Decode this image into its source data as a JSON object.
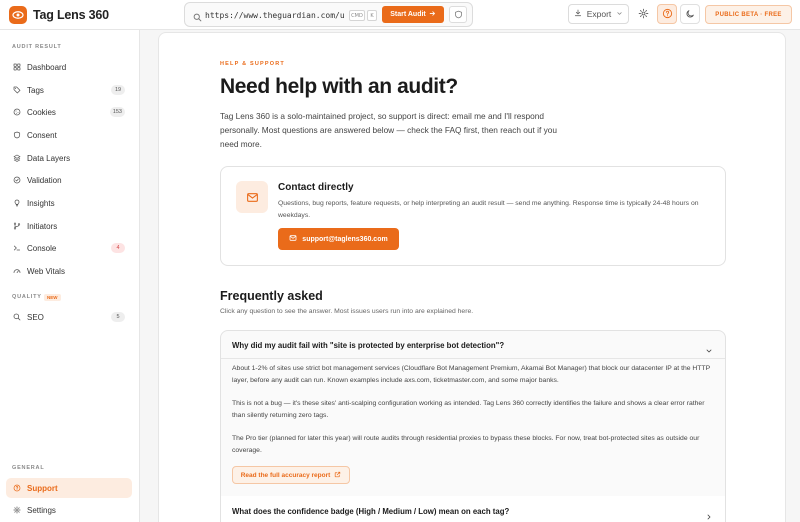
{
  "app": {
    "name": "Tag Lens 360"
  },
  "topbar": {
    "url_value": "https://www.theguardian.com/uk",
    "kbd_mod": "CMD",
    "kbd_key": "K",
    "start_label": "Start Audit",
    "export_label": "Export",
    "beta_label": "PUBLIC BETA · FREE"
  },
  "sidebar": {
    "section_audit": "AUDIT RESULT",
    "items": [
      {
        "label": "Dashboard",
        "icon": "grid-icon"
      },
      {
        "label": "Tags",
        "count": "19",
        "icon": "tag-icon"
      },
      {
        "label": "Cookies",
        "count": "153",
        "icon": "cookie-icon"
      },
      {
        "label": "Consent",
        "icon": "shield-icon"
      },
      {
        "label": "Data Layers",
        "icon": "layers-icon"
      },
      {
        "label": "Validation",
        "icon": "check-circle-icon"
      },
      {
        "label": "Insights",
        "icon": "lightbulb-icon"
      },
      {
        "label": "Initiators",
        "icon": "branch-icon"
      },
      {
        "label": "Console",
        "count": "4",
        "icon": "terminal-icon"
      },
      {
        "label": "Web Vitals",
        "icon": "gauge-icon"
      }
    ],
    "section_quality": "QUALITY",
    "quality_badge": "NEW",
    "seo": {
      "label": "SEO",
      "count": "5"
    },
    "section_general": "GENERAL",
    "support": {
      "label": "Support"
    },
    "settings": {
      "label": "Settings"
    }
  },
  "main": {
    "eyebrow": "HELP & SUPPORT",
    "title": "Need help with an audit?",
    "intro": "Tag Lens 360 is a solo-maintained project, so support is direct: email me and I'll respond personally. Most questions are answered below — check the FAQ first, then reach out if you need more.",
    "contact": {
      "title": "Contact directly",
      "desc": "Questions, bug reports, feature requests, or help interpreting an audit result — send me anything. Response time is typically 24-48 hours on weekdays.",
      "email": "support@taglens360.com"
    },
    "faq": {
      "heading": "Frequently asked",
      "sub": "Click any question to see the answer. Most issues users run into are explained here.",
      "open": {
        "question": "Why did my audit fail with \"site is protected by enterprise bot detection\"?",
        "p1": "About 1-2% of sites use strict bot management services (Cloudflare Bot Management Premium, Akamai Bot Manager) that block our datacenter IP at the HTTP layer, before any audit can run. Known examples include axs.com, ticketmaster.com, and some major banks.",
        "p2": "This is not a bug — it's these sites' anti-scalping configuration working as intended. Tag Lens 360 correctly identifies the failure and shows a clear error rather than silently returning zero tags.",
        "p3": "The Pro tier (planned for later this year) will route audits through residential proxies to bypass these blocks. For now, treat bot-protected sites as outside our coverage.",
        "link": "Read the full accuracy report"
      },
      "closed": {
        "question": "What does the confidence badge (High / Medium / Low) mean on each tag?"
      }
    }
  },
  "colors": {
    "accent": "#ea6b1a",
    "accent_soft": "#fdece0"
  }
}
